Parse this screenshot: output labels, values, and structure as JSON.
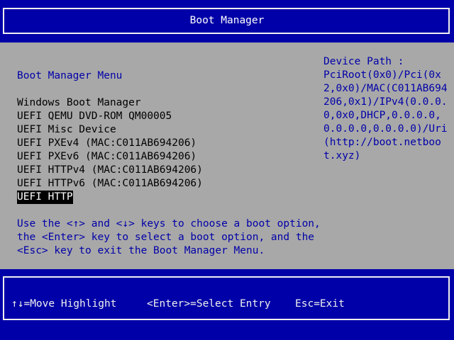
{
  "header": {
    "title": "Boot Manager"
  },
  "menu": {
    "title": "Boot Manager Menu",
    "items": [
      "Windows Boot Manager",
      "UEFI QEMU DVD-ROM QM00005",
      "UEFI Misc Device",
      "UEFI PXEv4 (MAC:C011AB694206)",
      "UEFI PXEv6 (MAC:C011AB694206)",
      "UEFI HTTPv4 (MAC:C011AB694206)",
      "UEFI HTTPv6 (MAC:C011AB694206)",
      "UEFI HTTP"
    ],
    "selected_index": 7
  },
  "help": {
    "line1": "Use the <↑> and <↓> keys to choose a boot option,",
    "line2": "the <Enter> key to select a boot option, and the",
    "line3": "<Esc> key to exit the Boot Manager Menu."
  },
  "device_path": {
    "label": "Device Path :",
    "value": "PciRoot(0x0)/Pci(0x2,0x0)/MAC(C011AB694206,0x1)/IPv4(0.0.0.0,0x0,DHCP,0.0.0.0,0.0.0.0,0.0.0.0)/Uri(http://boot.netboot.xyz)"
  },
  "footer": {
    "move": "↑↓=Move Highlight",
    "select": "<Enter>=Select Entry",
    "exit": "Esc=Exit"
  },
  "colors": {
    "background": "#0000a8",
    "panel": "#a8a8a8",
    "selected_bg": "#000000"
  }
}
